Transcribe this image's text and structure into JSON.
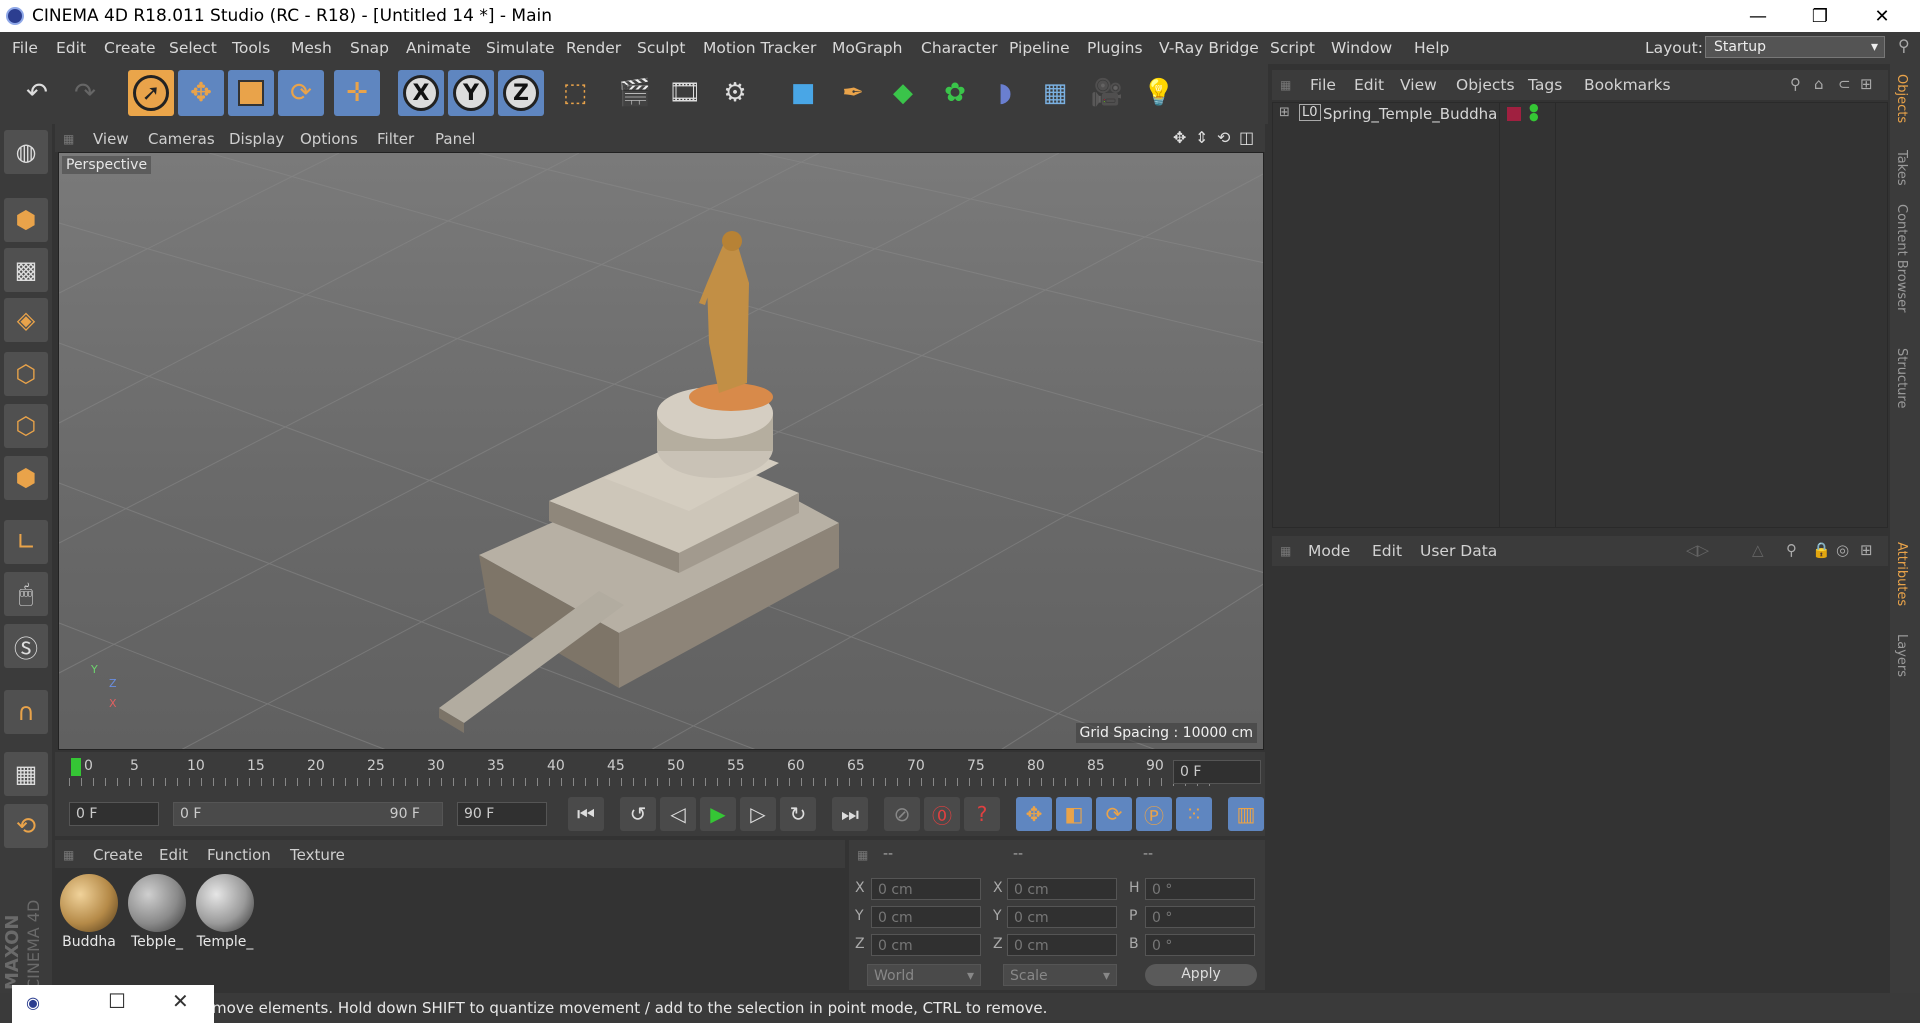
{
  "window": {
    "title": "CINEMA 4D R18.011 Studio (RC - R18) - [Untitled 14 *] - Main",
    "minimize": "—",
    "restore": "❐",
    "close": "✕"
  },
  "menubar": {
    "items": [
      "File",
      "Edit",
      "Create",
      "Select",
      "Tools",
      "Mesh",
      "Snap",
      "Animate",
      "Simulate",
      "Render",
      "Sculpt",
      "Motion Tracker",
      "MoGraph",
      "Character",
      "Pipeline",
      "Plugins",
      "V-Ray Bridge",
      "Script",
      "Window",
      "Help"
    ],
    "layout_label": "Layout:",
    "layout_value": "Startup"
  },
  "toolbar": {
    "axis_x": "X",
    "axis_y": "Y",
    "axis_z": "Z",
    "icons": [
      "undo-icon",
      "redo-icon",
      "select-arrow-icon",
      "move-icon",
      "scale-icon",
      "rotate-icon",
      "last-tool-icon",
      "axis-x-icon",
      "axis-y-icon",
      "axis-z-icon",
      "coordinate-system-icon",
      "render-view-icon",
      "render-picture-viewer-icon",
      "render-settings-icon",
      "cube-icon",
      "pen-icon",
      "subdivision-icon",
      "cloner-icon",
      "deformer-icon",
      "floor-icon",
      "camera-icon",
      "light-icon"
    ]
  },
  "viewport": {
    "menu": [
      "View",
      "Cameras",
      "Display",
      "Options",
      "Filter",
      "Panel"
    ],
    "label": "Perspective",
    "grid_spacing": "Grid Spacing : 10000 cm",
    "axis_x": "X",
    "axis_y": "Y",
    "axis_z": "Z"
  },
  "timeline": {
    "ticks": [
      "0",
      "5",
      "10",
      "15",
      "20",
      "25",
      "30",
      "35",
      "40",
      "45",
      "50",
      "55",
      "60",
      "65",
      "70",
      "75",
      "80",
      "85",
      "90"
    ],
    "current_frame": "0 F",
    "start_field": "0 F",
    "range_start": "0 F",
    "range_end": "90 F",
    "end_field": "90 F"
  },
  "materials": {
    "menu": [
      "Create",
      "Edit",
      "Function",
      "Texture"
    ],
    "items": [
      {
        "name": "Buddha",
        "color": "#b58a48"
      },
      {
        "name": "Tebple_",
        "color": "#8a8a8a"
      },
      {
        "name": "Temple_",
        "color": "#9a9a9a"
      }
    ]
  },
  "coordinates": {
    "headers": [
      "--",
      "--",
      "--"
    ],
    "rows": [
      {
        "l1": "X",
        "v1": "0 cm",
        "l2": "X",
        "v2": "0 cm",
        "l3": "H",
        "v3": "0 °"
      },
      {
        "l1": "Y",
        "v1": "0 cm",
        "l2": "Y",
        "v2": "0 cm",
        "l3": "P",
        "v3": "0 °"
      },
      {
        "l1": "Z",
        "v1": "0 cm",
        "l2": "Z",
        "v2": "0 cm",
        "l3": "B",
        "v3": "0 °"
      }
    ],
    "mode1": "World",
    "mode2": "Scale",
    "apply": "Apply"
  },
  "objects": {
    "menu": [
      "File",
      "Edit",
      "View",
      "Objects",
      "Tags",
      "Bookmarks"
    ],
    "items": [
      {
        "name": "Spring_Temple_Buddha",
        "layer_label": "L0"
      }
    ]
  },
  "attributes": {
    "menu": [
      "Mode",
      "Edit",
      "User Data"
    ]
  },
  "side_tabs": [
    "Objects",
    "Takes",
    "Content Browser",
    "Structure",
    "Attributes",
    "Layers"
  ],
  "status": {
    "text": "move elements. Hold down SHIFT to quantize movement / add to the selection in point mode, CTRL to remove."
  },
  "brand": {
    "maxon": "MAXON",
    "product": "CINEMA 4D"
  },
  "colors": {
    "accent_blue": "#5f86c0",
    "accent_orange": "#e9a34a",
    "play_green": "#35c635"
  }
}
